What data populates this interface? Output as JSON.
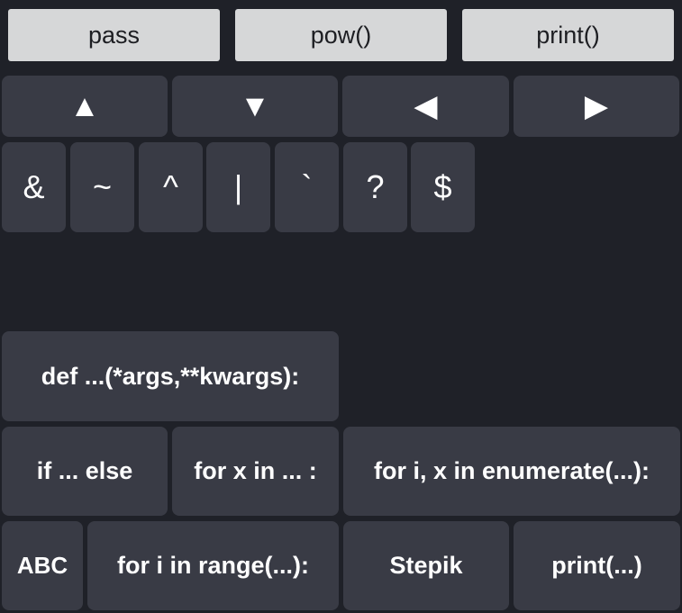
{
  "top_row": {
    "pass": "pass",
    "pow": "pow()",
    "print": "print()"
  },
  "arrows": {
    "up": "▲",
    "down": "▼",
    "left": "◀",
    "right": "▶"
  },
  "symbols": [
    "&",
    "~",
    "^",
    "|",
    "`",
    "?",
    "$"
  ],
  "snippets": {
    "def_args": "def ...(*args,**kwargs):",
    "if_else": "if ... else",
    "for_x_in": "for x in ... :",
    "for_enumerate": "for i, x in enumerate(...):",
    "abc": "ABC",
    "for_range": "for i in range(...):",
    "stepik": "Stepik",
    "print_call": "print(...)"
  }
}
